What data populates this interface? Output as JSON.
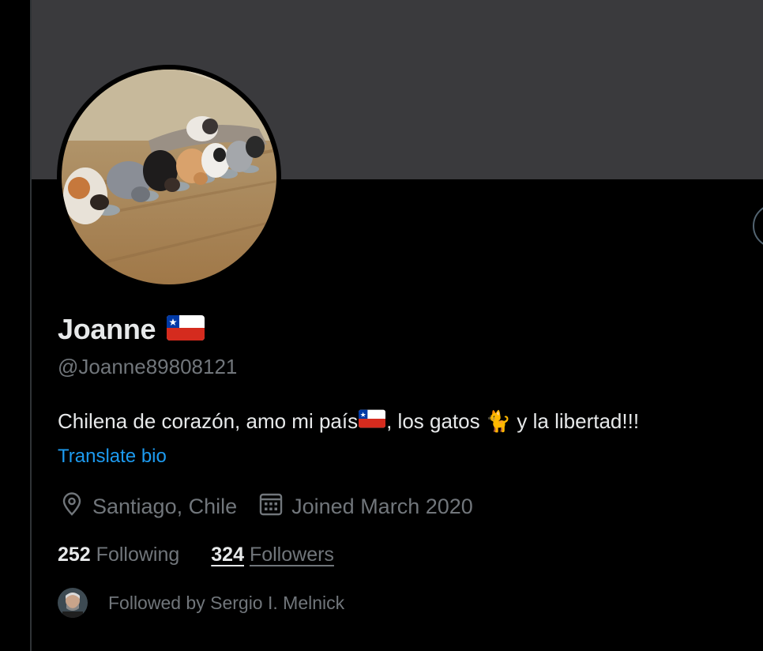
{
  "profile": {
    "name": "Joanne",
    "handle": "@Joanne89808121",
    "bio_part1": "Chilena de corazón, amo mi país",
    "bio_part2": ", los gatos ",
    "bio_cat": "🐈",
    "bio_part3": " y la libertad!!!",
    "translate_label": "Translate bio",
    "location": "Santiago, Chile",
    "joined": "Joined March 2020",
    "following_count": "252",
    "following_label": "Following",
    "followers_count": "324",
    "followers_label": "Followers",
    "followed_by": "Followed by Sergio I. Melnick"
  },
  "icons": {
    "location": "location-pin-icon",
    "calendar": "calendar-icon",
    "flag": "chile-flag-icon"
  },
  "colors": {
    "background": "#000000",
    "banner": "#3a3a3d",
    "text_primary": "#e7e9ea",
    "text_secondary": "#71767b",
    "link": "#1d9bf0"
  }
}
